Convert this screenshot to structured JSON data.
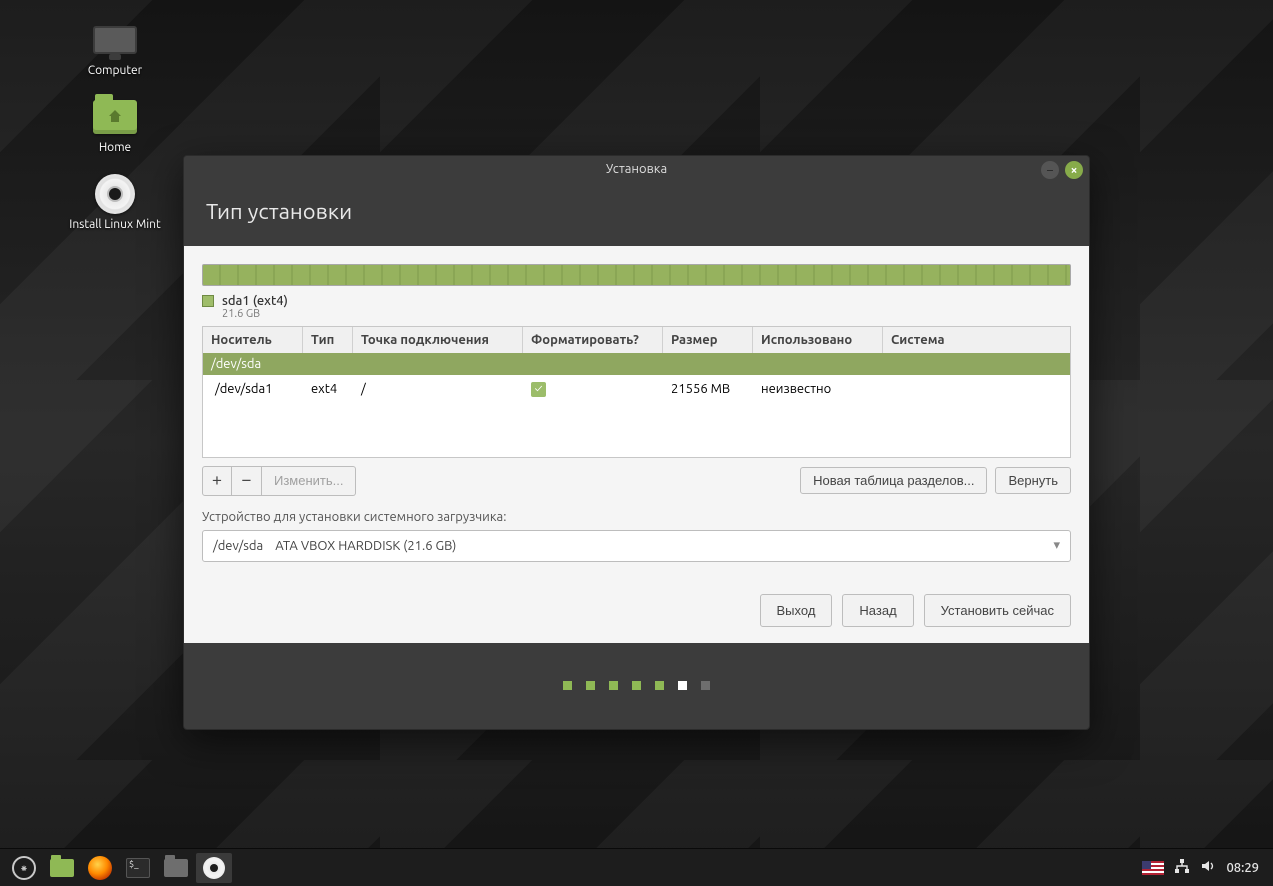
{
  "desktop": {
    "computer": "Computer",
    "home": "Home",
    "install": "Install Linux Mint"
  },
  "window": {
    "title": "Установка",
    "heading": "Тип установки"
  },
  "partition": {
    "name": "sda1 (ext4)",
    "size": "21.6 GB"
  },
  "columns": {
    "device": "Носитель",
    "type": "Тип",
    "mount": "Точка подключения",
    "format": "Форматировать?",
    "size": "Размер",
    "used": "Использовано",
    "system": "Система"
  },
  "diskRow": "/dev/sda",
  "rows": [
    {
      "device": "/dev/sda1",
      "type": "ext4",
      "mount": "/",
      "format": true,
      "size": "21556 MB",
      "used": "неизвестно",
      "system": ""
    }
  ],
  "toolbar": {
    "add": "+",
    "remove": "−",
    "change": "Изменить...",
    "newTable": "Новая таблица разделов...",
    "revert": "Вернуть"
  },
  "boot": {
    "label": "Устройство для установки системного загрузчика:",
    "device": "/dev/sda",
    "desc": "ATA VBOX HARDDISK (21.6 GB)"
  },
  "actions": {
    "quit": "Выход",
    "back": "Назад",
    "install": "Установить сейчас"
  },
  "pager": {
    "total": 7,
    "current": 6
  },
  "tray": {
    "lang": "US",
    "clock": "08:29"
  },
  "icons": {
    "computer": "computer-icon",
    "home": "home-folder-icon",
    "disc": "disc-icon",
    "minimize": "minimize-icon",
    "close": "close-icon",
    "chevron": "chevron-down-icon",
    "check": "check-icon",
    "menu": "mint-menu-icon",
    "folder": "folder-icon",
    "firefox": "firefox-icon",
    "terminal": "terminal-icon",
    "filemanager": "filemanager-icon",
    "network": "network-icon",
    "volume": "volume-icon",
    "flag": "us-flag-icon"
  }
}
